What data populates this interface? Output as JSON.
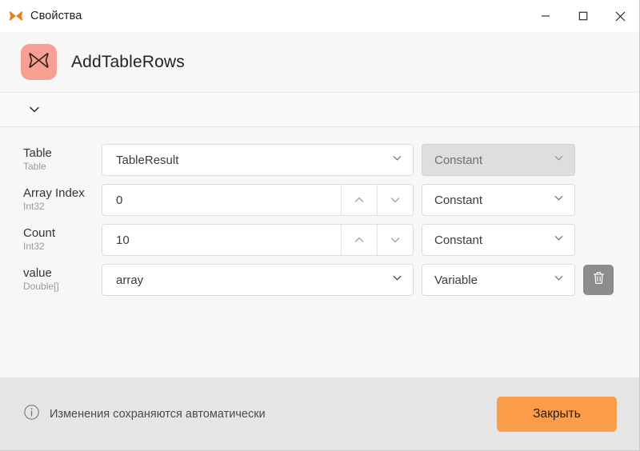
{
  "window": {
    "title": "Свойства",
    "title_icon": "butterfly-icon",
    "controls": {
      "minimize": "minimize-icon",
      "maximize": "maximize-icon",
      "close": "close-icon"
    }
  },
  "header": {
    "badge_icon": "butterfly-icon",
    "badge_color": "#f79f92",
    "title": "AddTableRows"
  },
  "expander": {
    "icon": "chevron-down-icon"
  },
  "properties": [
    {
      "name": "Table",
      "type": "Table",
      "control": "combo",
      "value": "TableResult",
      "mode": "Constant",
      "mode_disabled": true,
      "has_delete": false
    },
    {
      "name": "Array Index",
      "type": "Int32",
      "control": "number",
      "value": "0",
      "mode": "Constant",
      "mode_disabled": false,
      "has_delete": false
    },
    {
      "name": "Count",
      "type": "Int32",
      "control": "number",
      "value": "10",
      "mode": "Constant",
      "mode_disabled": false,
      "has_delete": false
    },
    {
      "name": "value",
      "type": "Double[]",
      "control": "combo",
      "value": "array",
      "mode": "Variable",
      "mode_disabled": false,
      "has_delete": true
    }
  ],
  "footer": {
    "info_icon": "info-circle-icon",
    "note": "Изменения сохраняются автоматически",
    "close_label": "Закрыть",
    "close_color": "#fb9d4b"
  }
}
